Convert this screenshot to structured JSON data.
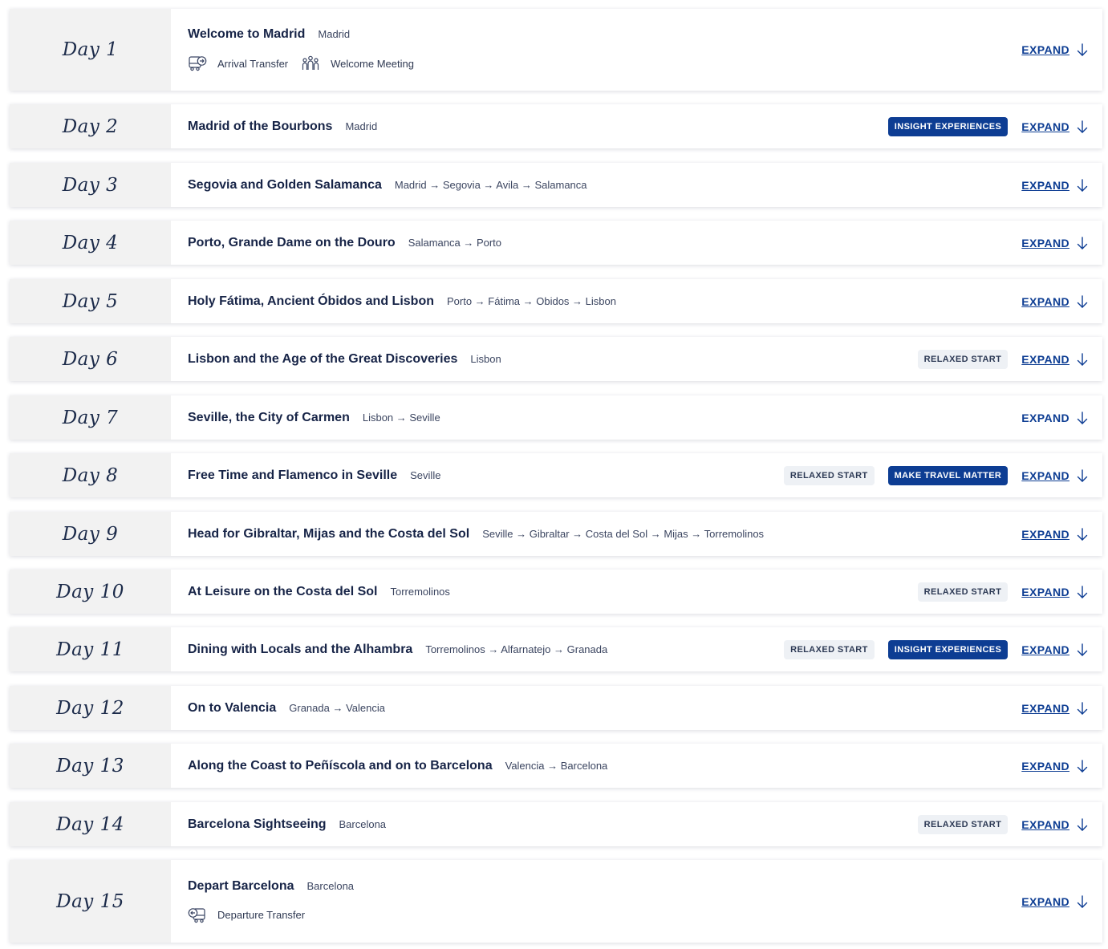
{
  "colors": {
    "navy": "#0d3d93",
    "title": "#172447",
    "label_bg": "#f2f2f2",
    "relaxed_bg": "#eef1f5"
  },
  "days": [
    {
      "label": "Day 1",
      "title": "Welcome to Madrid",
      "route": "Madrid",
      "features": [
        {
          "icon": "bus-icon",
          "label": "Arrival Transfer"
        },
        {
          "icon": "group-icon",
          "label": "Welcome Meeting"
        }
      ],
      "badges": [],
      "expand": "EXPAND"
    },
    {
      "label": "Day 2",
      "title": "Madrid of the Bourbons",
      "route": "Madrid",
      "features": [],
      "badges": [
        {
          "text": "INSIGHT EXPERIENCES",
          "type": "insight"
        }
      ],
      "expand": "EXPAND"
    },
    {
      "label": "Day 3",
      "title": "Segovia and Golden Salamanca",
      "route": "Madrid → Segovia → Avila → Salamanca",
      "features": [],
      "badges": [],
      "expand": "EXPAND"
    },
    {
      "label": "Day 4",
      "title": "Porto, Grande Dame on the Douro",
      "route": "Salamanca → Porto",
      "features": [],
      "badges": [],
      "expand": "EXPAND"
    },
    {
      "label": "Day 5",
      "title": "Holy Fátima, Ancient Óbidos and Lisbon",
      "route": "Porto → Fátima → Obidos → Lisbon",
      "features": [],
      "badges": [],
      "expand": "EXPAND"
    },
    {
      "label": "Day 6",
      "title": "Lisbon and the Age of the Great Discoveries",
      "route": "Lisbon",
      "features": [],
      "badges": [
        {
          "text": "RELAXED START",
          "type": "relaxed"
        }
      ],
      "expand": "EXPAND"
    },
    {
      "label": "Day 7",
      "title": "Seville, the City of Carmen",
      "route": "Lisbon → Seville",
      "features": [],
      "badges": [],
      "expand": "EXPAND",
      "expand_hovered": true
    },
    {
      "label": "Day 8",
      "title": "Free Time and Flamenco in Seville",
      "route": "Seville",
      "features": [],
      "badges": [
        {
          "text": "RELAXED START",
          "type": "relaxed"
        },
        {
          "text": "MAKE TRAVEL MATTER",
          "type": "insight"
        }
      ],
      "expand": "EXPAND"
    },
    {
      "label": "Day 9",
      "title": "Head for Gibraltar, Mijas and the Costa del Sol",
      "route": "Seville → Gibraltar → Costa del Sol → Mijas → Torremolinos",
      "features": [],
      "badges": [],
      "expand": "EXPAND"
    },
    {
      "label": "Day 10",
      "title": "At Leisure on the Costa del Sol",
      "route": "Torremolinos",
      "features": [],
      "badges": [
        {
          "text": "RELAXED START",
          "type": "relaxed"
        }
      ],
      "expand": "EXPAND"
    },
    {
      "label": "Day 11",
      "title": "Dining with Locals and the Alhambra",
      "route": "Torremolinos → Alfarnatejo → Granada",
      "features": [],
      "badges": [
        {
          "text": "RELAXED START",
          "type": "relaxed"
        },
        {
          "text": "INSIGHT EXPERIENCES",
          "type": "insight"
        }
      ],
      "expand": "EXPAND"
    },
    {
      "label": "Day 12",
      "title": "On to Valencia",
      "route": "Granada → Valencia",
      "features": [],
      "badges": [],
      "expand": "EXPAND"
    },
    {
      "label": "Day 13",
      "title": "Along the Coast to Peñíscola and on to Barcelona",
      "route": "Valencia → Barcelona",
      "features": [],
      "badges": [],
      "expand": "EXPAND"
    },
    {
      "label": "Day 14",
      "title": "Barcelona Sightseeing",
      "route": "Barcelona",
      "features": [],
      "badges": [
        {
          "text": "RELAXED START",
          "type": "relaxed"
        }
      ],
      "expand": "EXPAND"
    },
    {
      "label": "Day 15",
      "title": "Depart Barcelona",
      "route": "Barcelona",
      "features": [
        {
          "icon": "bus-departure-icon",
          "label": "Departure Transfer"
        }
      ],
      "badges": [],
      "expand": "EXPAND"
    }
  ]
}
